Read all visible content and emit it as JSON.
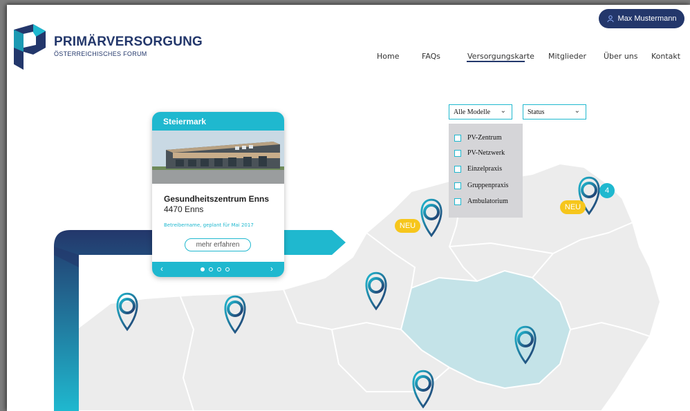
{
  "user": {
    "name": "Max Mustermann",
    "icon": "user-icon"
  },
  "brand": {
    "title": "PRIMÄRVERSORGUNG",
    "subtitle": "ÖSTERREICHISCHES FORUM"
  },
  "nav": {
    "items": [
      {
        "label": "Home"
      },
      {
        "label": "FAQs"
      },
      {
        "label": "Versorgungskarte",
        "active": true
      },
      {
        "label": "Mitglieder"
      },
      {
        "label": "Über uns"
      },
      {
        "label": "Kontakt"
      }
    ]
  },
  "filters": {
    "model_select": {
      "value": "Alle Modelle"
    },
    "status_select": {
      "value": "Status"
    },
    "model_options": [
      {
        "label": "PV-Zentrum"
      },
      {
        "label": "PV-Netzwerk"
      },
      {
        "label": "Einzelpraxis"
      },
      {
        "label": "Gruppenpraxis"
      },
      {
        "label": "Ambulatorium"
      }
    ]
  },
  "card": {
    "region": "Steiermark",
    "name": "Gesundheitszentrum Enns",
    "city": "4470 Enns",
    "note": "Betreibername, geplant für Mai 2017",
    "button": "mehr erfahren",
    "prev": "‹",
    "next": "›",
    "slide_count": 4,
    "active_slide": 1
  },
  "markers": {
    "neu_label": "NEU",
    "cluster_count": "4"
  },
  "colors": {
    "accent": "#1fb8cf",
    "navy": "#23376b",
    "map_gray": "#ececec",
    "highlight_region": "#c4e3e8",
    "neu": "#f6c61c"
  }
}
